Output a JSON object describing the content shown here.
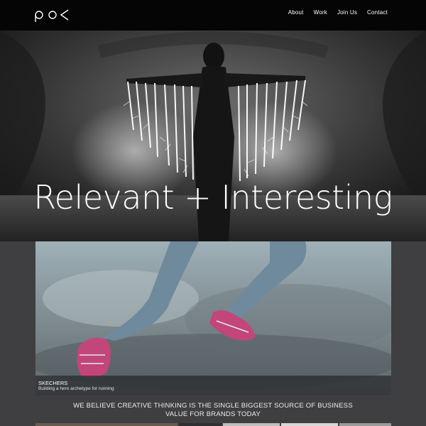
{
  "header": {
    "logo_text": "po<",
    "nav": [
      "About",
      "Work",
      "Join Us",
      "Contact"
    ]
  },
  "hero": {
    "title": "Relevant + Interesting"
  },
  "feature": {
    "title": "SKECHERS",
    "subtitle": "Building a hero archetype for running"
  },
  "tagline": {
    "line1": "WE BELIEVE CREATIVE THINKING IS THE SINGLE BIGGEST SOURCE OF BUSINESS",
    "line2": "VALUE FOR BRANDS TODAY"
  },
  "colors": {
    "topbar": "#050505",
    "page_bg": "#3f3f42",
    "leggings": "#6f8a9c",
    "shoe_pink": "#c2467a"
  }
}
